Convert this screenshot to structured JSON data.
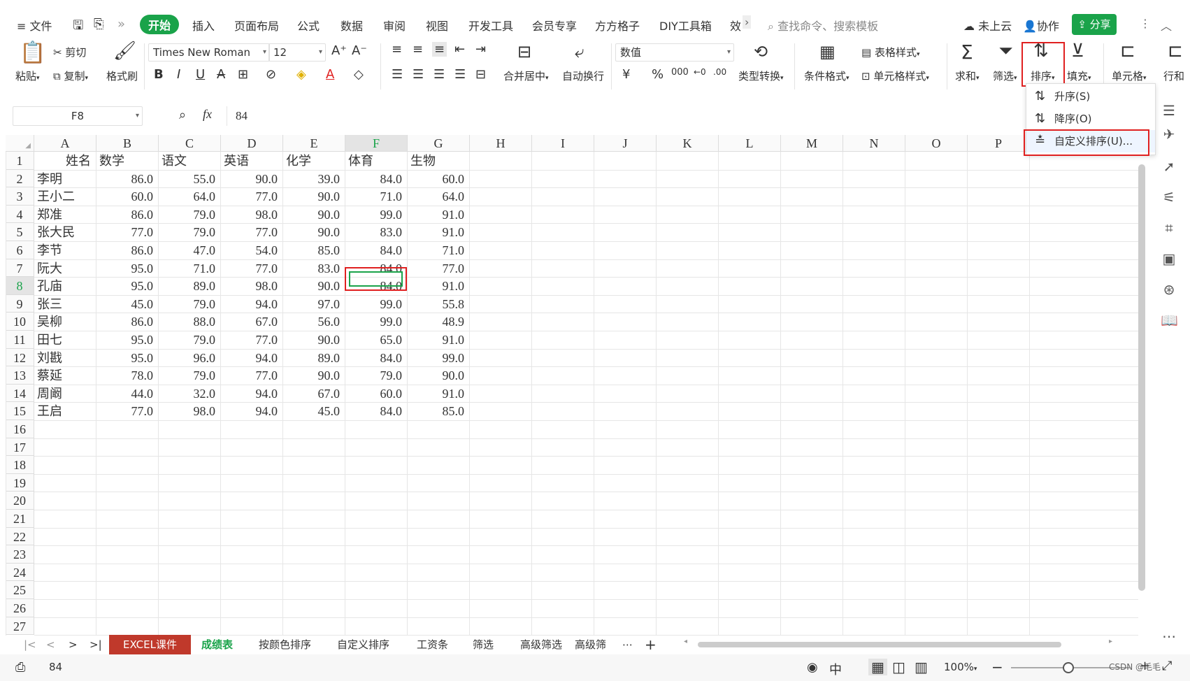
{
  "menu": {
    "hamburger": "≡",
    "file": "文件",
    "tabs": [
      "开始",
      "插入",
      "页面布局",
      "公式",
      "数据",
      "审阅",
      "视图",
      "开发工具",
      "会员专享",
      "方方格子",
      "DIY工具箱",
      "效"
    ],
    "search_placeholder": "查找命令、搜索模板",
    "cloud": "未上云",
    "collab": "协作",
    "share": "分享"
  },
  "ribbon": {
    "paste": "粘贴",
    "cut": "剪切",
    "copy": "复制",
    "format_painter": "格式刷",
    "font_name": "Times New Roman",
    "font_size": "12",
    "merge_center": "合并居中",
    "wrap": "自动换行",
    "number_format": "数值",
    "type_convert": "类型转换",
    "cond_format": "条件格式",
    "table_style": "表格样式",
    "cell_style": "单元格样式",
    "sum": "求和",
    "filter": "筛选",
    "sort": "排序",
    "fill": "填充",
    "cell": "单元格",
    "rowcol": "行和"
  },
  "sort_menu": {
    "asc": "升序(S)",
    "desc": "降序(O)",
    "custom": "自定义排序(U)..."
  },
  "formula_bar": {
    "name_box": "F8",
    "fx": "fx",
    "value": "84"
  },
  "columns": [
    "A",
    "B",
    "C",
    "D",
    "E",
    "F",
    "G",
    "H",
    "I",
    "J",
    "K",
    "L",
    "M",
    "N",
    "O",
    "P"
  ],
  "rows": [
    "1",
    "2",
    "3",
    "4",
    "5",
    "6",
    "7",
    "8",
    "9",
    "10",
    "11",
    "12",
    "13",
    "14",
    "15",
    "16",
    "17",
    "18",
    "19",
    "20",
    "21",
    "22",
    "23",
    "24",
    "25",
    "26",
    "27"
  ],
  "headers": [
    "姓名",
    "数学",
    "语文",
    "英语",
    "化学",
    "体育",
    "生物"
  ],
  "table": [
    [
      "李明",
      "86.0",
      "55.0",
      "90.0",
      "39.0",
      "84.0",
      "60.0"
    ],
    [
      "王小二",
      "60.0",
      "64.0",
      "77.0",
      "90.0",
      "71.0",
      "64.0"
    ],
    [
      "郑准",
      "86.0",
      "79.0",
      "98.0",
      "90.0",
      "99.0",
      "91.0"
    ],
    [
      "张大民",
      "77.0",
      "79.0",
      "77.0",
      "90.0",
      "83.0",
      "91.0"
    ],
    [
      "李节",
      "86.0",
      "47.0",
      "54.0",
      "85.0",
      "84.0",
      "71.0"
    ],
    [
      "阮大",
      "95.0",
      "71.0",
      "77.0",
      "83.0",
      "84.0",
      "77.0"
    ],
    [
      "孔庙",
      "95.0",
      "89.0",
      "98.0",
      "90.0",
      "84.0",
      "91.0"
    ],
    [
      "张三",
      "45.0",
      "79.0",
      "94.0",
      "97.0",
      "99.0",
      "55.8"
    ],
    [
      "吴柳",
      "86.0",
      "88.0",
      "67.0",
      "56.0",
      "99.0",
      "48.9"
    ],
    [
      "田七",
      "95.0",
      "79.0",
      "77.0",
      "90.0",
      "65.0",
      "91.0"
    ],
    [
      "刘戡",
      "95.0",
      "96.0",
      "94.0",
      "89.0",
      "84.0",
      "99.0"
    ],
    [
      "蔡延",
      "78.0",
      "79.0",
      "77.0",
      "90.0",
      "79.0",
      "90.0"
    ],
    [
      "周阚",
      "44.0",
      "32.0",
      "94.0",
      "67.0",
      "60.0",
      "91.0"
    ],
    [
      "王启",
      "77.0",
      "98.0",
      "94.0",
      "45.0",
      "84.0",
      "85.0"
    ]
  ],
  "sheets": [
    "EXCEL课件",
    "成绩表",
    "按颜色排序",
    "自定义排序",
    "工资条",
    "筛选",
    "高级筛选",
    "高级筛"
  ],
  "status": {
    "value": "84",
    "zoom": "100%",
    "watermark": "CSDN @毛毛"
  },
  "colors": {
    "accent": "#1aa34a",
    "highlight": "#e02020",
    "active_tab": "#c0392b"
  }
}
